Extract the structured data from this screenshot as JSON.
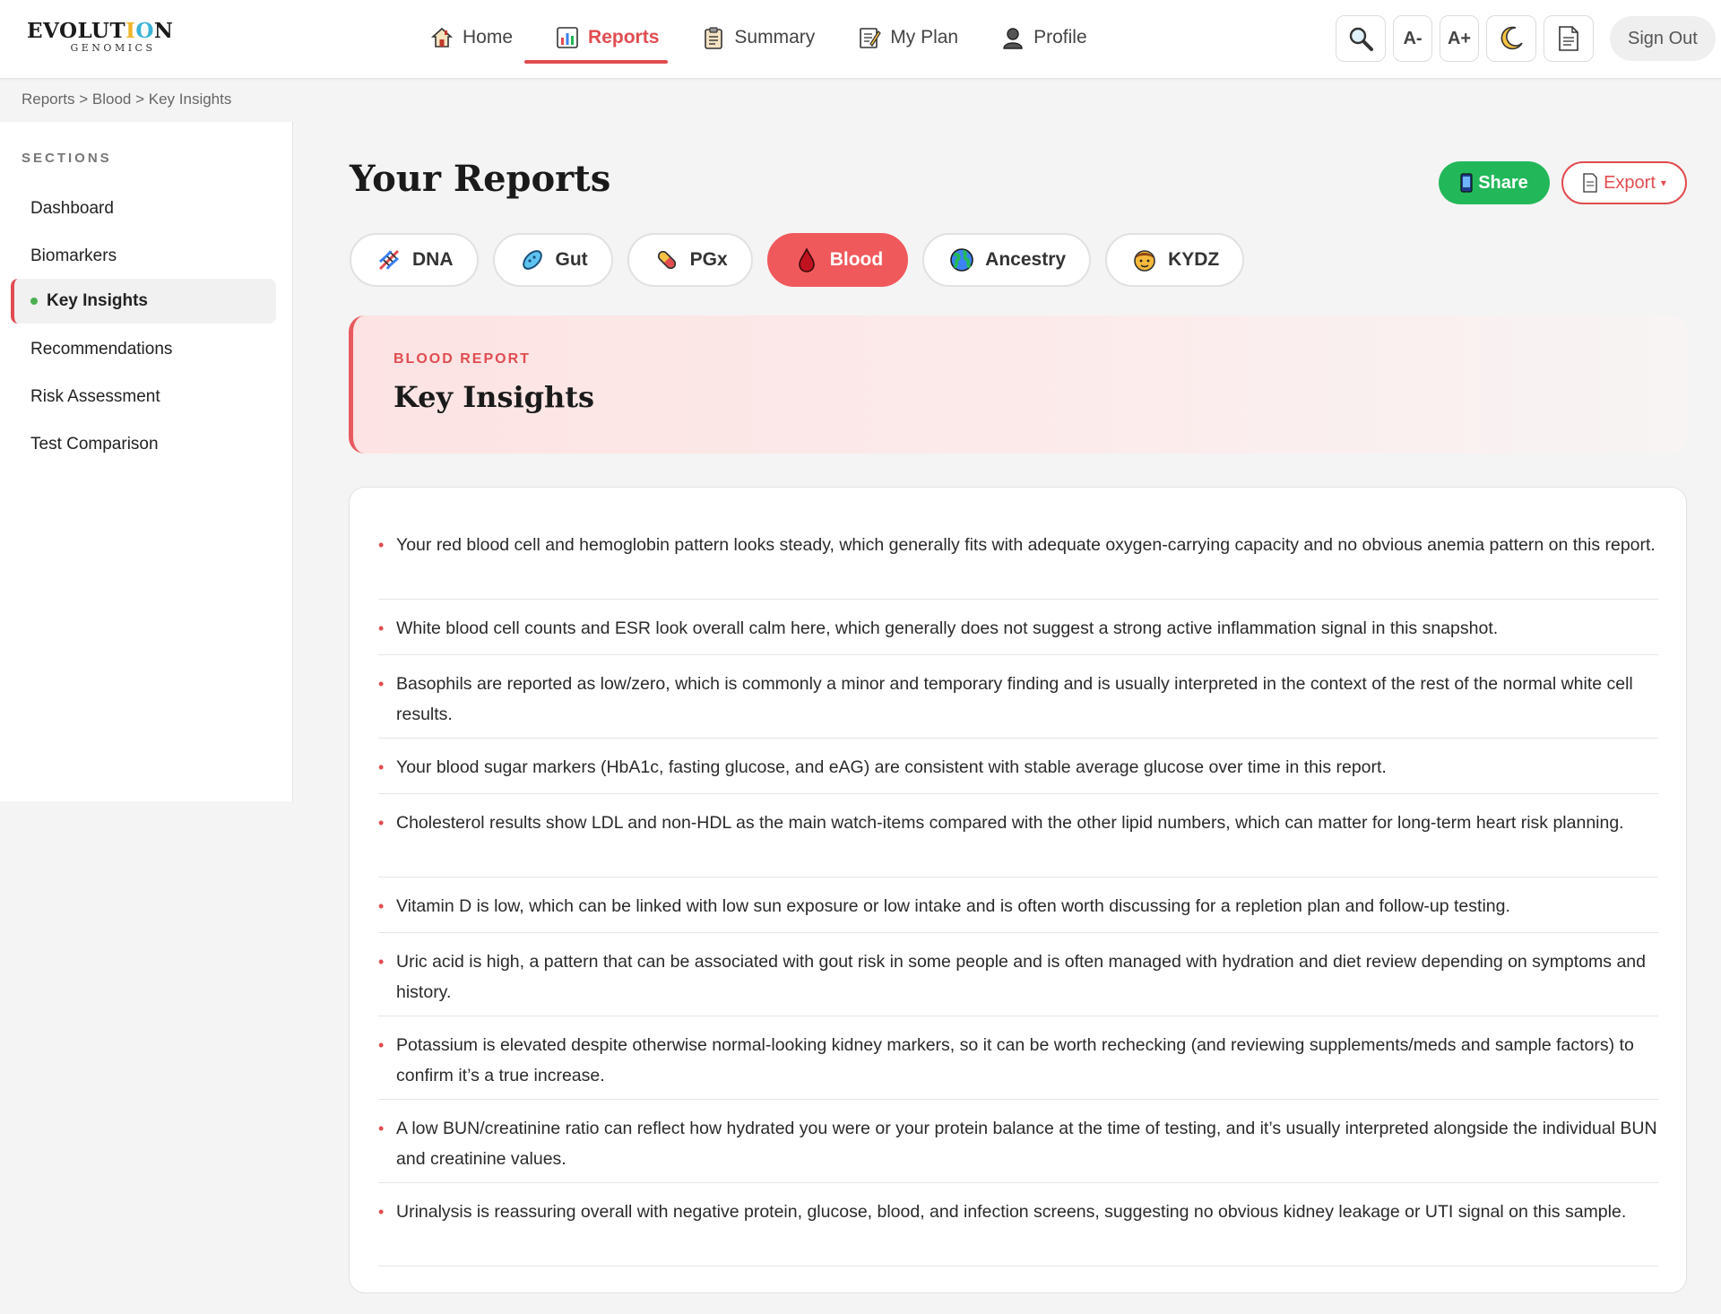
{
  "brand": {
    "name_part1": "EVOLUT",
    "name_i": "I",
    "name_o": "O",
    "name_n": "N",
    "sub": "GENOMICS"
  },
  "nav": [
    {
      "label": "Home",
      "icon": "home-icon"
    },
    {
      "label": "Reports",
      "icon": "chart-icon",
      "active": true
    },
    {
      "label": "Summary",
      "icon": "clipboard-icon"
    },
    {
      "label": "My Plan",
      "icon": "memo-icon"
    },
    {
      "label": "Profile",
      "icon": "user-icon"
    }
  ],
  "tools": {
    "font_decrease": "A-",
    "font_increase": "A+",
    "sign_out": "Sign Out"
  },
  "breadcrumb": "Reports > Blood > Key Insights",
  "sidebar": {
    "title": "SECTIONS",
    "items": [
      {
        "label": "Dashboard"
      },
      {
        "label": "Biomarkers"
      },
      {
        "label": "Key Insights",
        "active": true
      },
      {
        "label": "Recommendations"
      },
      {
        "label": "Risk Assessment"
      },
      {
        "label": "Test Comparison"
      }
    ]
  },
  "main": {
    "title": "Your Reports",
    "share_label": "Share",
    "export_label": "Export",
    "export_caret": "▾",
    "tabs": [
      {
        "label": "DNA",
        "icon": "dna-icon"
      },
      {
        "label": "Gut",
        "icon": "microbe-icon"
      },
      {
        "label": "PGx",
        "icon": "pill-icon"
      },
      {
        "label": "Blood",
        "icon": "blood-drop-icon",
        "active": true
      },
      {
        "label": "Ancestry",
        "icon": "globe-icon"
      },
      {
        "label": "KYDZ",
        "icon": "child-icon"
      }
    ],
    "hero": {
      "kicker": "BLOOD REPORT",
      "title": "Key Insights"
    },
    "bullet": "•",
    "insights": [
      "Your red blood cell and hemoglobin pattern looks steady, which generally fits with adequate oxygen-carrying capacity and no obvious anemia pattern on this report.",
      "White blood cell counts and ESR look overall calm here, which generally does not suggest a strong active inflammation signal in this snapshot.",
      "Basophils are reported as low/zero, which is commonly a minor and temporary finding and is usually interpreted in the context of the rest of the normal white cell results.",
      "Your blood sugar markers (HbA1c, fasting glucose, and eAG) are consistent with stable average glucose over time in this report.",
      "Cholesterol results show LDL and non-HDL as the main watch-items compared with the other lipid numbers, which can matter for long-term heart risk planning.",
      "Vitamin D is low, which can be linked with low sun exposure or low intake and is often worth discussing for a repletion plan and follow-up testing.",
      "Uric acid is high, a pattern that can be associated with gout risk in some people and is often managed with hydration and diet review depending on symptoms and history.",
      "Potassium is elevated despite otherwise normal-looking kidney markers, so it can be worth rechecking (and reviewing supplements/meds and sample factors) to confirm it’s a true increase.",
      "A low BUN/creatinine ratio can reflect how hydrated you were or your protein balance at the time of testing, and it’s usually interpreted alongside the individual BUN and creatinine values.",
      "Urinalysis is reassuring overall with negative protein, glucose, blood, and infection screens, suggesting no obvious kidney leakage or UTI signal on this sample."
    ]
  },
  "colors": {
    "accent": "#e14c50",
    "share": "#22b85a",
    "active_dot": "#4caf50"
  }
}
